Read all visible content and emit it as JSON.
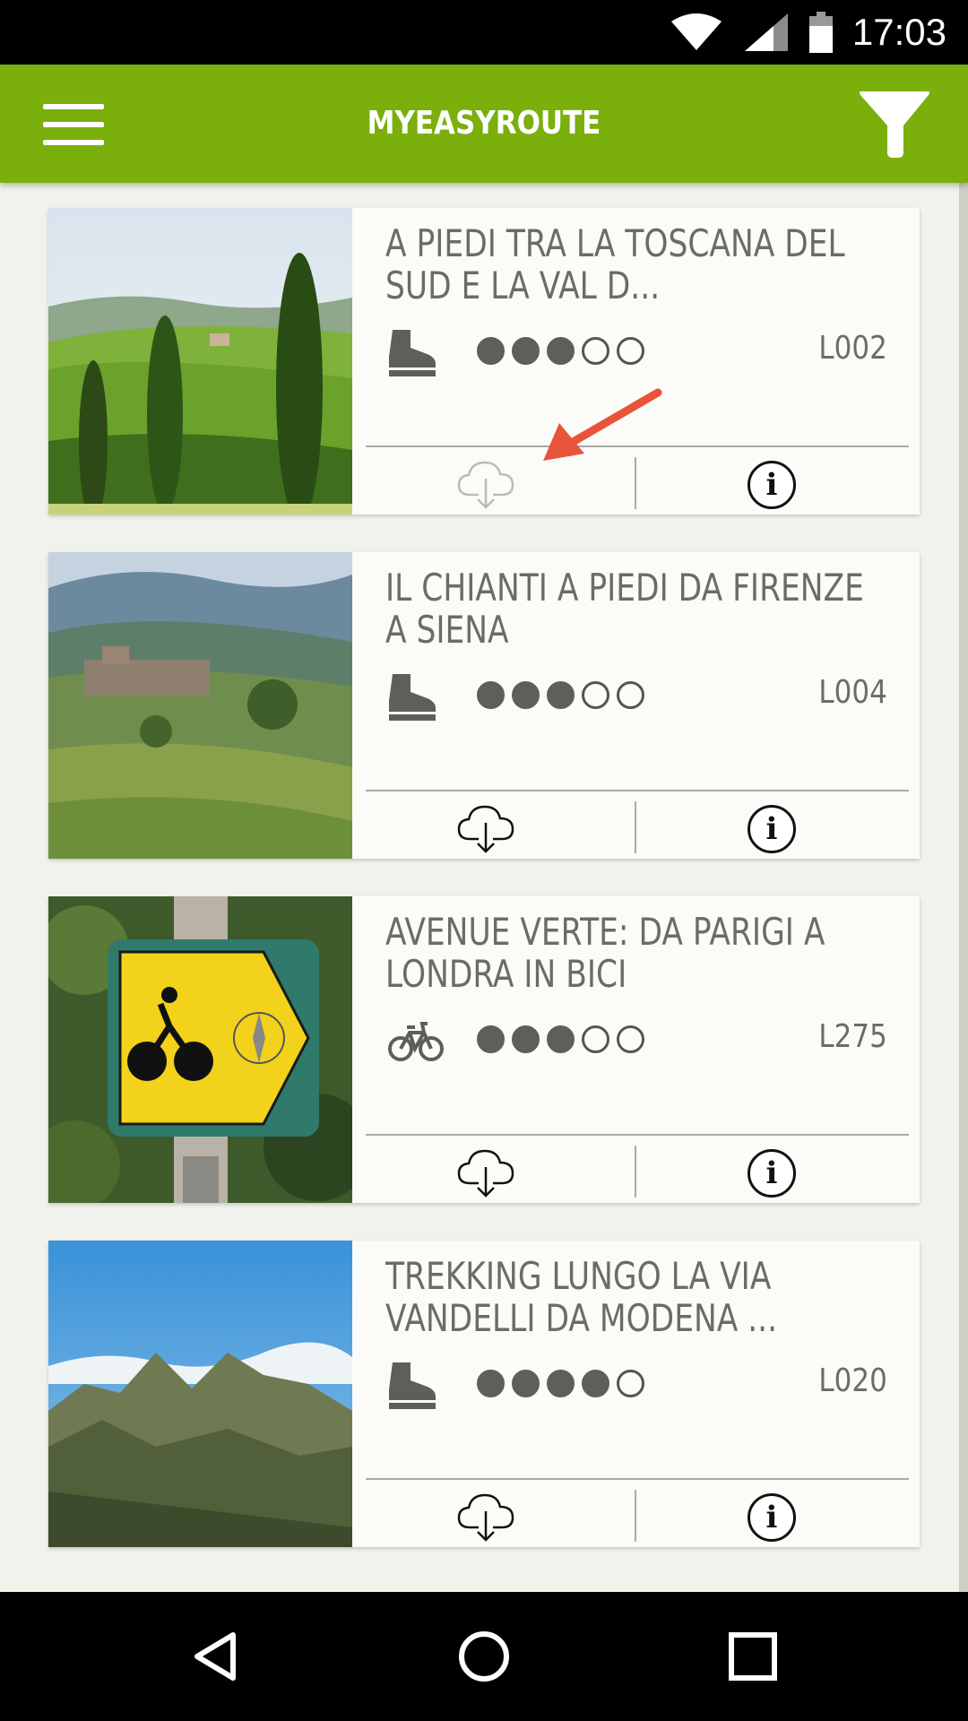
{
  "status_bar": {
    "time": "17:03"
  },
  "app_bar": {
    "title": "MYEASYROUTE"
  },
  "colors": {
    "accent": "#7aaf0c",
    "text": "#6b6b68",
    "arrow": "#e8543a"
  },
  "routes": [
    {
      "title": "A PIEDI TRA LA TOSCANA DEL SUD E LA VAL D...",
      "activity": "hiking-boot-icon",
      "difficulty": 3,
      "difficulty_max": 5,
      "code": "L002",
      "download_state": "disabled"
    },
    {
      "title": "IL CHIANTI A PIEDI DA FIRENZE A SIENA",
      "activity": "hiking-boot-icon",
      "difficulty": 3,
      "difficulty_max": 5,
      "code": "L004",
      "download_state": "enabled"
    },
    {
      "title": "AVENUE VERTE: DA PARIGI A LONDRA IN BICI",
      "activity": "bicycle-icon",
      "difficulty": 3,
      "difficulty_max": 5,
      "code": "L275",
      "download_state": "enabled"
    },
    {
      "title": "TREKKING LUNGO LA VIA VANDELLI DA MODENA ...",
      "activity": "hiking-boot-icon",
      "difficulty": 4,
      "difficulty_max": 5,
      "code": "L020",
      "download_state": "enabled"
    }
  ],
  "info_glyph": "i"
}
